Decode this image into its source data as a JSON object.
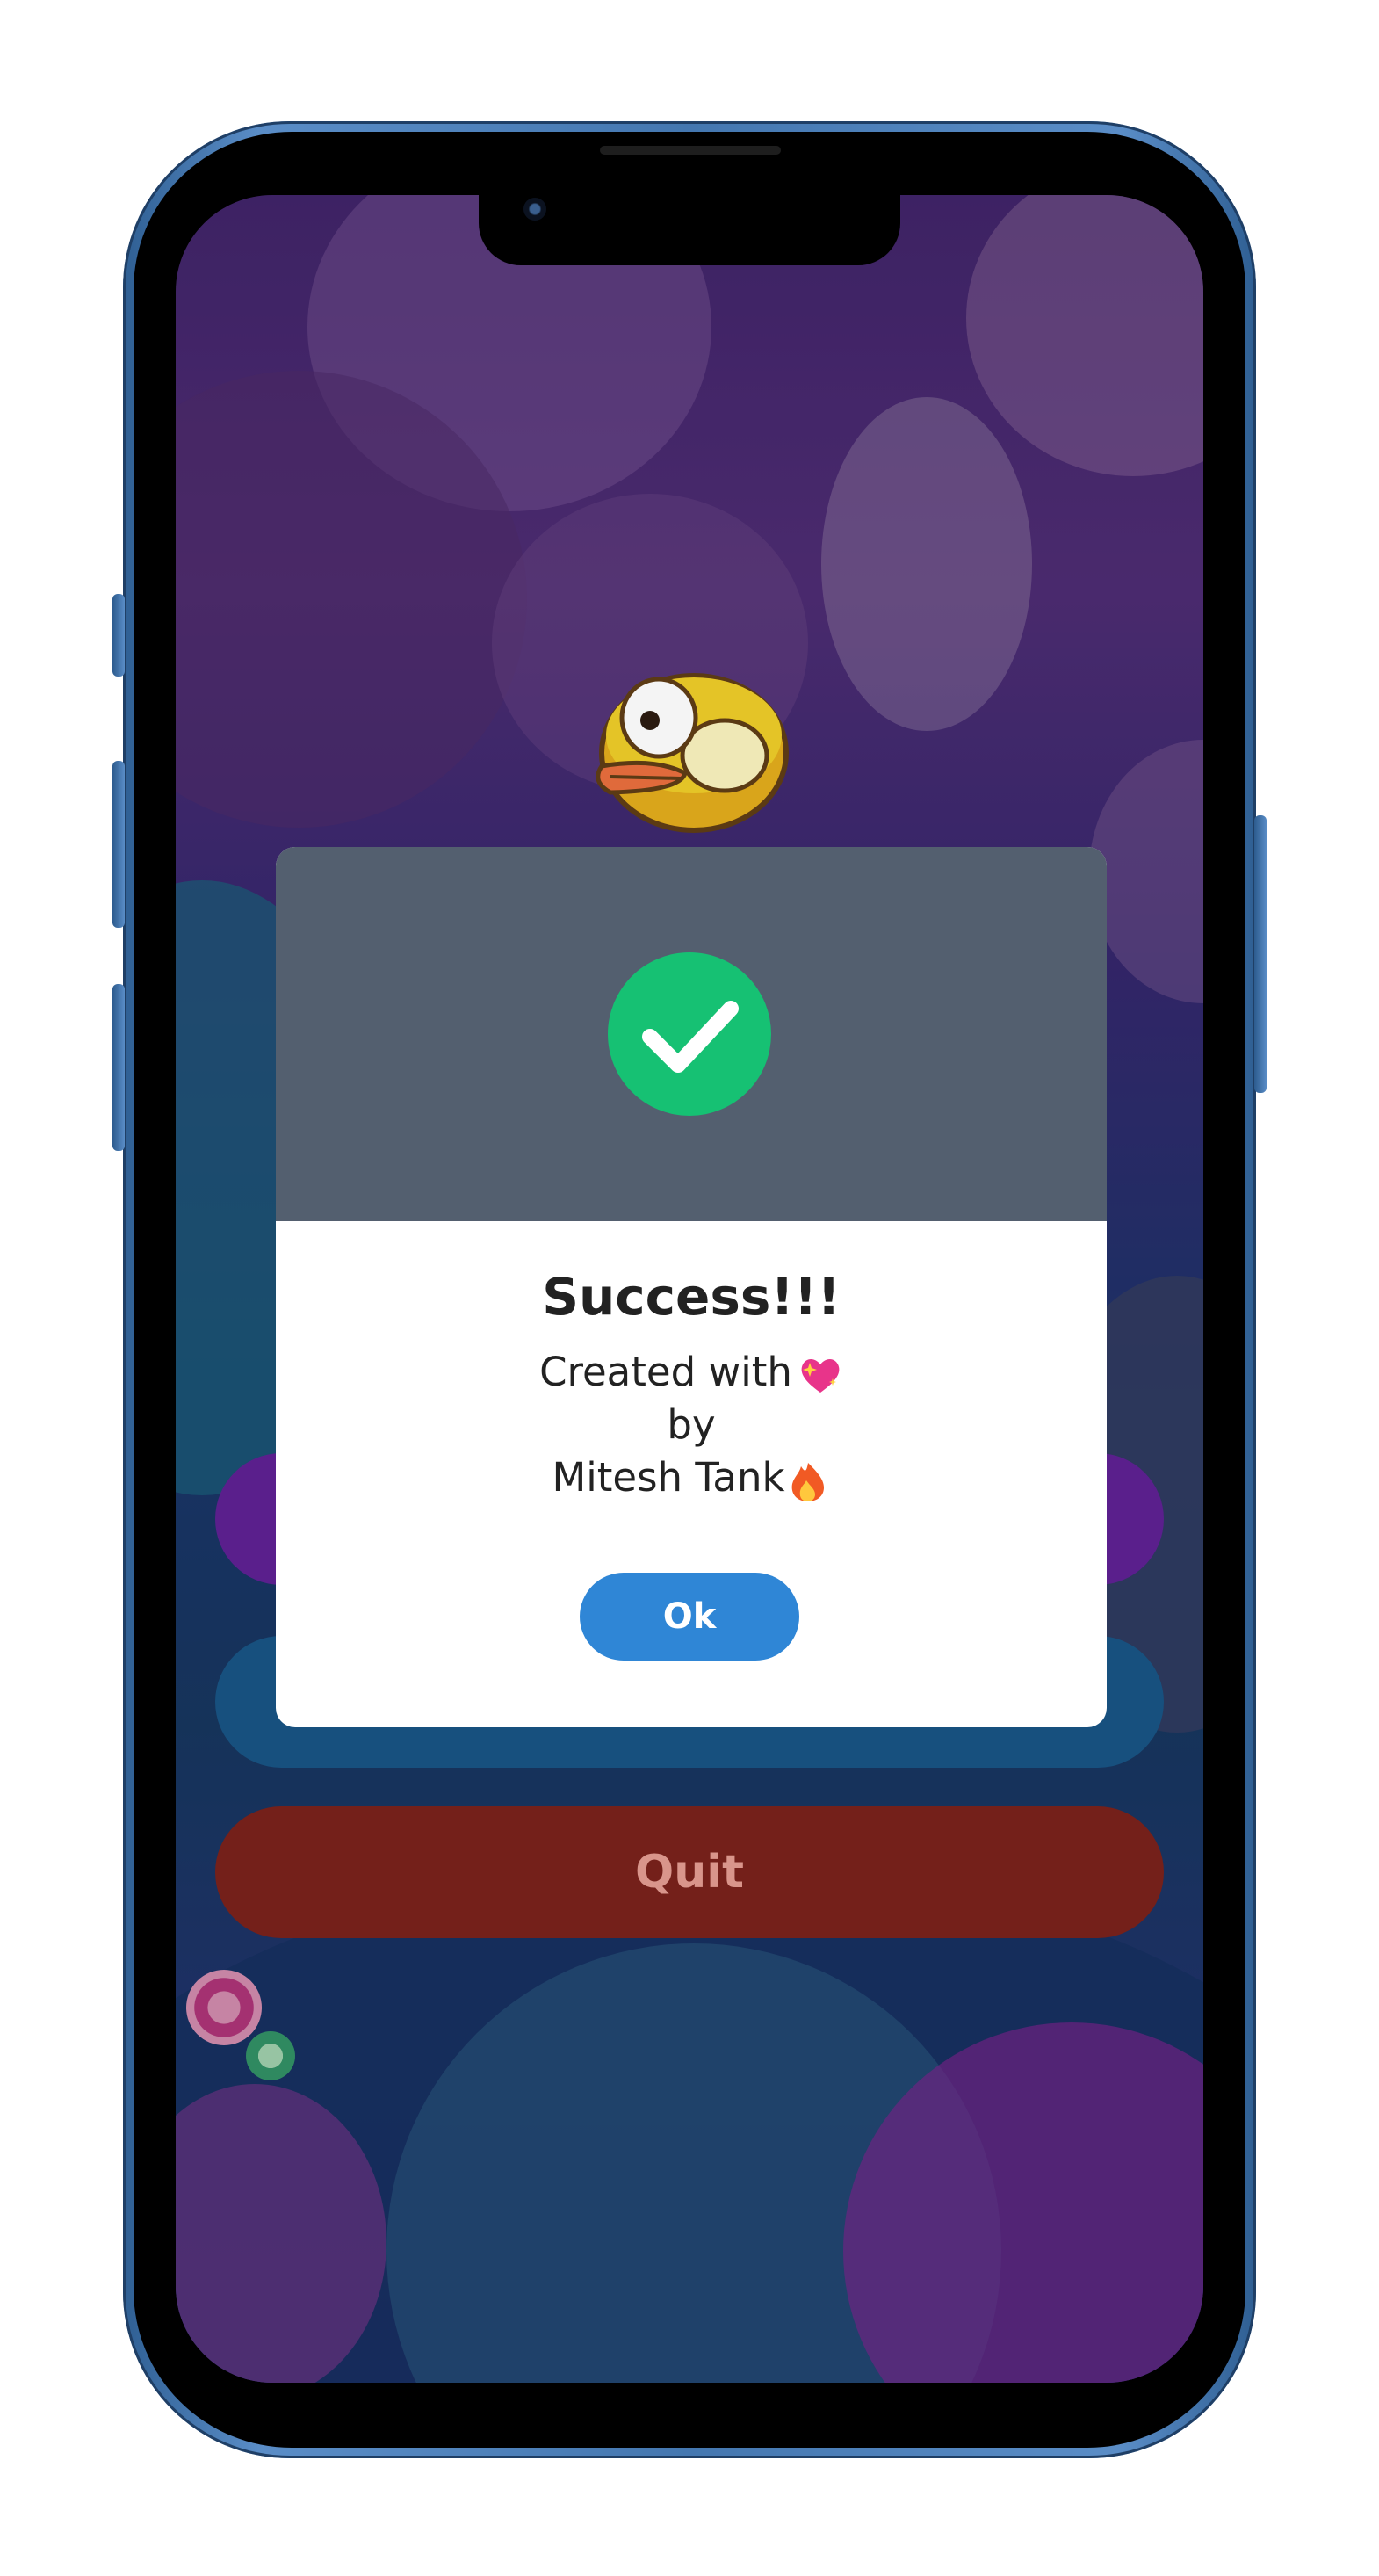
{
  "dialog": {
    "title": "Success!!!",
    "line1": "Created with",
    "line2": "by",
    "line3": "Mitesh Tank",
    "ok_label": "Ok",
    "icon": "check-circle-icon",
    "header_color": "#535f6f",
    "success_color": "#16c173",
    "ok_color": "#2f86d6"
  },
  "menu": {
    "buttons": [
      {
        "label": "",
        "color": "#5a1f8c"
      },
      {
        "label": "",
        "color": "#17507e"
      },
      {
        "label": "Quit",
        "color": "#74201a"
      }
    ]
  },
  "icons": {
    "heart": "sparkling-heart-icon",
    "fire": "fire-icon",
    "bird": "flappy-bird-icon"
  }
}
